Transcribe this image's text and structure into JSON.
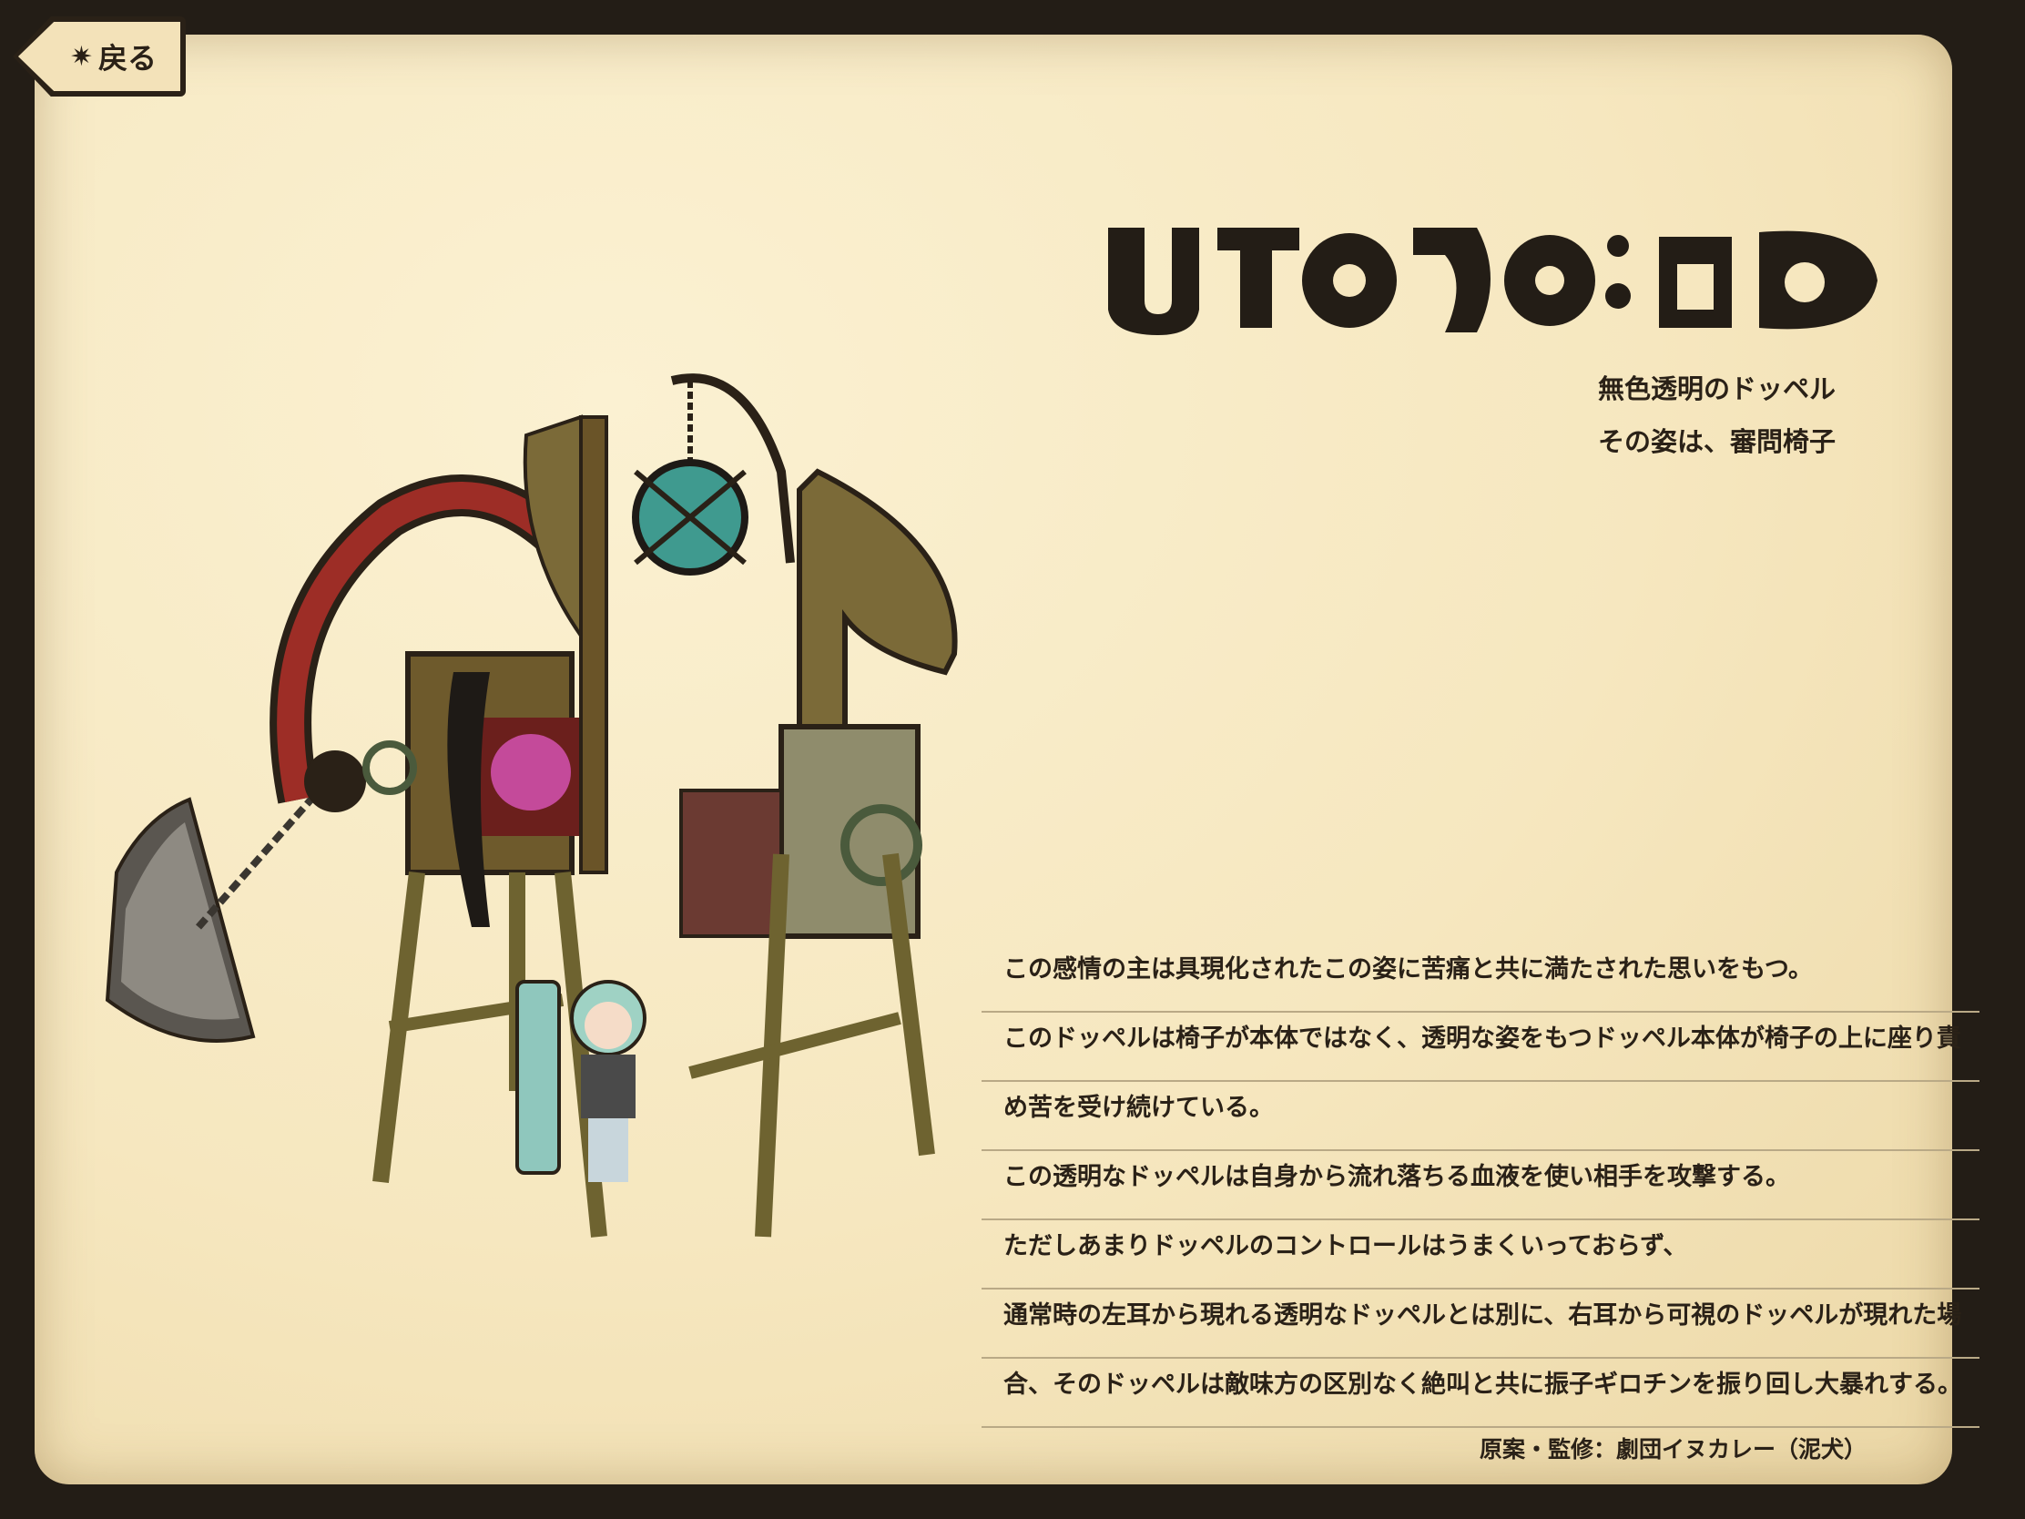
{
  "back_button": {
    "label": "戻る",
    "icon": "back-arrow-icon"
  },
  "title_logo": "ウワサの椅子ドッペル",
  "subtitle": [
    "無色透明のドッペル",
    "その姿は、審問椅子"
  ],
  "description": [
    "この感情の主は具現化されたこの姿に苦痛と共に満たされた思いをもつ。",
    "このドッペルは椅子が本体ではなく、透明な姿をもつドッペル本体が椅子の上に座り責",
    "め苦を受け続けている。",
    "この透明なドッペルは自身から流れ落ちる血液を使い相手を攻撃する。",
    "ただしあまりドッペルのコントロールはうまくいっておらず、",
    "通常時の左耳から現れる透明なドッペルとは別に、右耳から可視のドッペルが現れた場",
    "合、そのドッペルは敵味方の区別なく絶叫と共に振子ギロチンを振り回し大暴れする。"
  ],
  "credit": "原案・監修：劇団イヌカレー（泥犬）",
  "colors": {
    "frame": "#231d16",
    "page": "#f6e7bf",
    "text": "#2a2117",
    "rule": "#b9a986"
  }
}
